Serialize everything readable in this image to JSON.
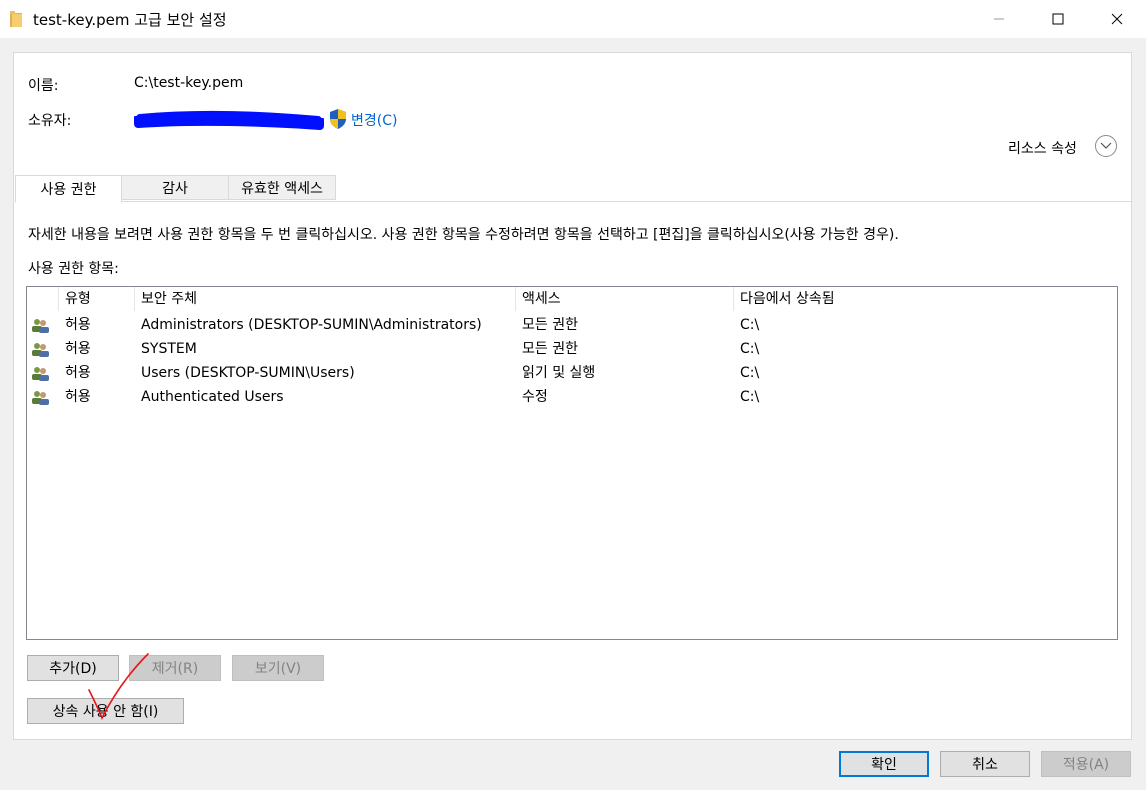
{
  "window": {
    "title": "test-key.pem 고급 보안 설정",
    "icon": "folder-icon",
    "controls": [
      "minimize-icon",
      "maximize-icon",
      "close-icon"
    ]
  },
  "info": {
    "name_label": "이름:",
    "name_value": "C:\\test-key.pem",
    "owner_label": "소유자:",
    "owner_change_link": "변경(C)",
    "resource_props_label": "리소스 속성"
  },
  "tabs": [
    {
      "label": "사용 권한",
      "active": true
    },
    {
      "label": "감사",
      "active": false
    },
    {
      "label": "유효한 액세스",
      "active": false
    }
  ],
  "description": "자세한 내용을 보려면 사용 권한 항목을 두 번 클릭하십시오. 사용 권한 항목을 수정하려면 항목을 선택하고 [편집]을 클릭하십시오(사용 가능한 경우).",
  "entries_label": "사용 권한 항목:",
  "table": {
    "columns": [
      "유형",
      "보안 주체",
      "액세스",
      "다음에서 상속됨"
    ],
    "rows": [
      {
        "type": "허용",
        "principal": "Administrators (DESKTOP-SUMIN\\Administrators)",
        "access": "모든 권한",
        "inherited_from": "C:\\"
      },
      {
        "type": "허용",
        "principal": "SYSTEM",
        "access": "모든 권한",
        "inherited_from": "C:\\"
      },
      {
        "type": "허용",
        "principal": "Users (DESKTOP-SUMIN\\Users)",
        "access": "읽기 및 실행",
        "inherited_from": "C:\\"
      },
      {
        "type": "허용",
        "principal": "Authenticated Users",
        "access": "수정",
        "inherited_from": "C:\\"
      }
    ]
  },
  "buttons": {
    "add": "추가(D)",
    "remove": "제거(R)",
    "view": "보기(V)",
    "disable_inheritance": "상속 사용 안 함(I)",
    "ok": "확인",
    "cancel": "취소",
    "apply": "적용(A)"
  },
  "colors": {
    "link": "#0066cc",
    "annotation": "#e8131b",
    "redaction": "#0010ff"
  }
}
